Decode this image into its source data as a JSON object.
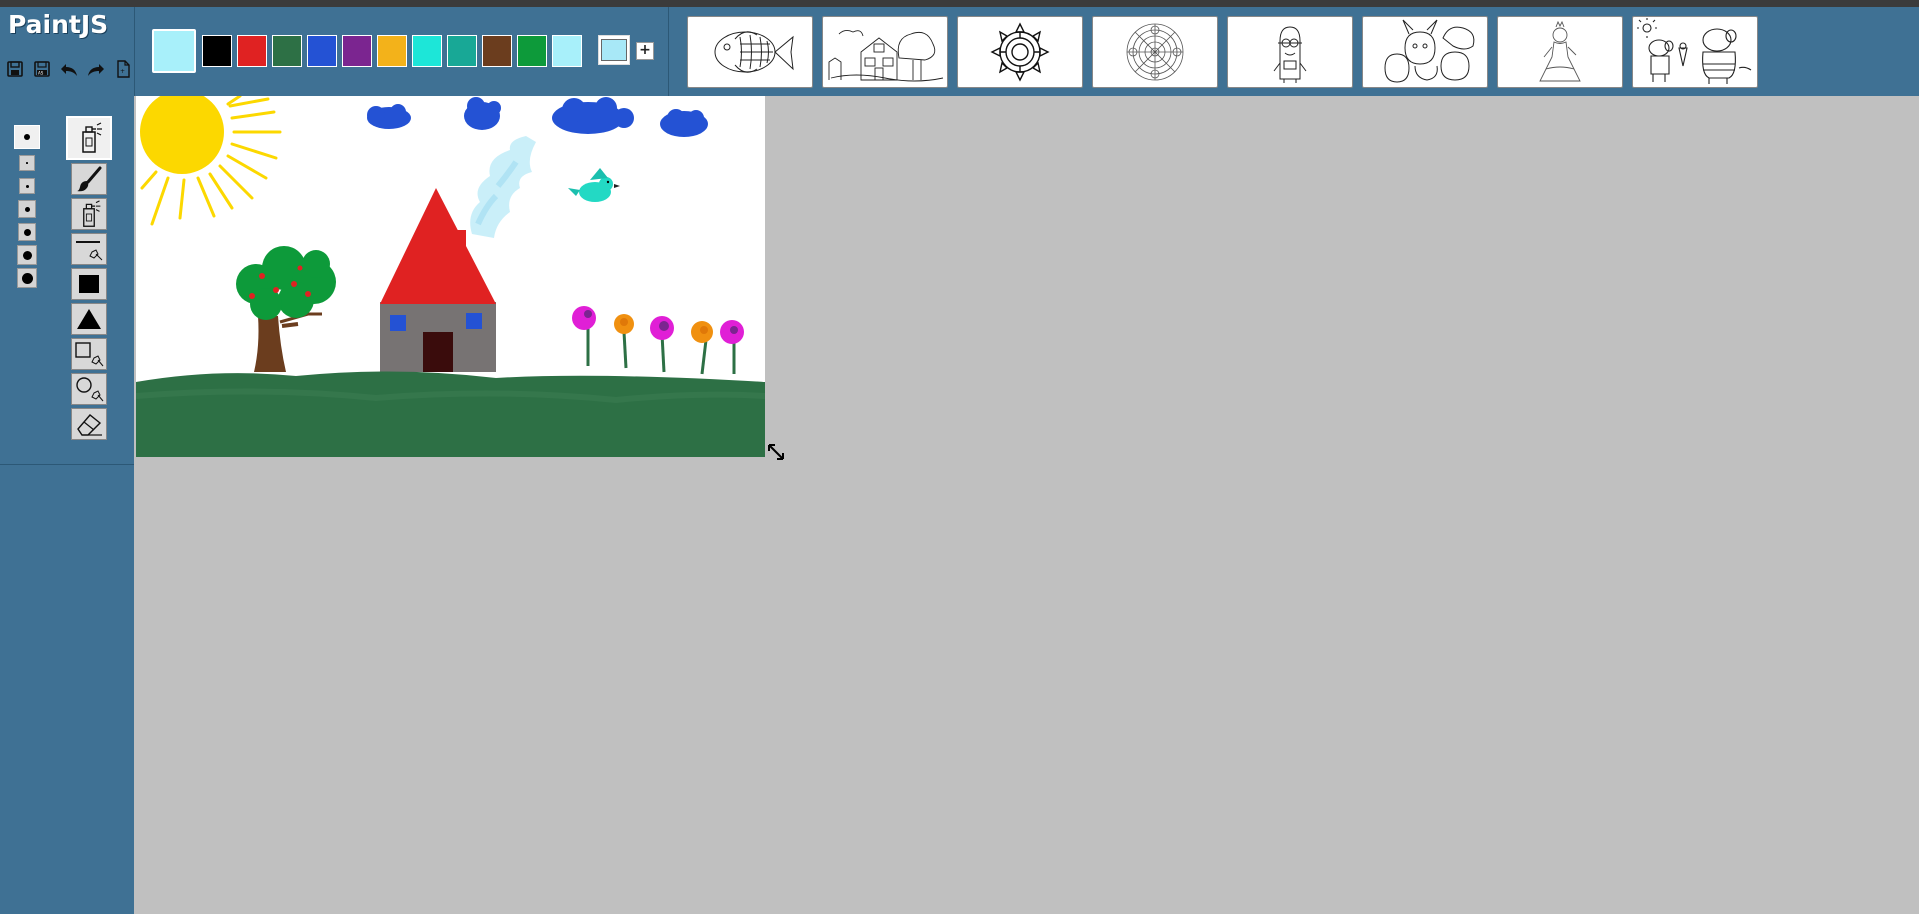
{
  "app": {
    "title": "PaintJS"
  },
  "file_actions": [
    {
      "name": "save",
      "icon": "save-icon"
    },
    {
      "name": "save-as",
      "icon": "save-as-icon"
    },
    {
      "name": "undo",
      "icon": "undo-icon"
    },
    {
      "name": "redo",
      "icon": "redo-icon"
    },
    {
      "name": "new",
      "icon": "new-file-icon"
    }
  ],
  "current_color": "#a8f0fa",
  "palette": [
    "#000000",
    "#e02222",
    "#2d7045",
    "#2452d4",
    "#7b2590",
    "#f3b21a",
    "#1de6d8",
    "#18a896",
    "#6b3d1e",
    "#0d9a3a",
    "#a8f0fa"
  ],
  "custom_color": "#a8e8f7",
  "add_color_label": "+",
  "templates": [
    {
      "name": "rainbow-fish"
    },
    {
      "name": "house-with-trees"
    },
    {
      "name": "sun-mandala"
    },
    {
      "name": "round-mandala"
    },
    {
      "name": "minion"
    },
    {
      "name": "pokemon-group"
    },
    {
      "name": "princess"
    },
    {
      "name": "peppa-pig"
    }
  ],
  "brush_sizes": [
    {
      "level": 0,
      "selected": true
    },
    {
      "level": 1
    },
    {
      "level": 2
    },
    {
      "level": 3
    },
    {
      "level": 4
    },
    {
      "level": 5
    },
    {
      "level": 6
    }
  ],
  "tools": [
    {
      "name": "spray",
      "icon": "spray-can-icon",
      "active": true
    },
    {
      "name": "brush",
      "icon": "paintbrush-icon"
    },
    {
      "name": "spray-alt",
      "icon": "spray-can-icon"
    },
    {
      "name": "line",
      "icon": "line-icon"
    },
    {
      "name": "rectangle-fill",
      "icon": "filled-square-icon"
    },
    {
      "name": "triangle-fill",
      "icon": "filled-triangle-icon"
    },
    {
      "name": "rectangle-outline",
      "icon": "square-outline-icon"
    },
    {
      "name": "circle-outline",
      "icon": "circle-outline-icon"
    },
    {
      "name": "eraser",
      "icon": "eraser-icon"
    }
  ]
}
